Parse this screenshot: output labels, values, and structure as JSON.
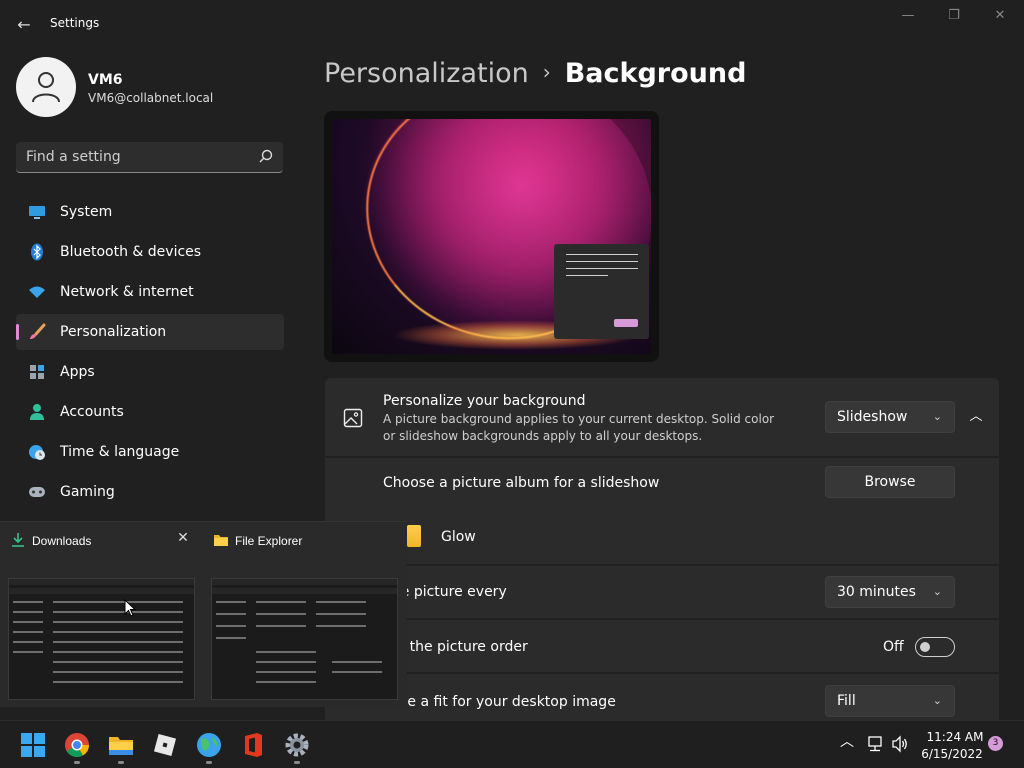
{
  "window": {
    "title": "Settings",
    "back_glyph": "←",
    "controls": {
      "minimize": "—",
      "maximize": "❐",
      "close": "✕"
    }
  },
  "profile": {
    "name": "VM6",
    "email": "VM6@collabnet.local"
  },
  "search": {
    "placeholder": "Find a setting",
    "icon": "search-icon"
  },
  "sidebar": {
    "items": [
      {
        "label": "System",
        "icon": "monitor-icon",
        "active": false
      },
      {
        "label": "Bluetooth & devices",
        "icon": "bluetooth-icon",
        "active": false
      },
      {
        "label": "Network & internet",
        "icon": "wifi-icon",
        "active": false
      },
      {
        "label": "Personalization",
        "icon": "brush-icon",
        "active": true
      },
      {
        "label": "Apps",
        "icon": "apps-icon",
        "active": false
      },
      {
        "label": "Accounts",
        "icon": "person-icon",
        "active": false
      },
      {
        "label": "Time & language",
        "icon": "globe-clock-icon",
        "active": false
      },
      {
        "label": "Gaming",
        "icon": "gamepad-icon",
        "active": false
      }
    ],
    "active_color": "#e08ad8"
  },
  "breadcrumb": {
    "parent": "Personalization",
    "separator": "›",
    "current": "Background"
  },
  "background_card": {
    "title": "Personalize your background",
    "description": "A picture background applies to your current desktop. Solid color or slideshow backgrounds apply to all your desktops.",
    "selected": "Slideshow",
    "chevron": "⌄",
    "collapse_glyph": "︿"
  },
  "settings": {
    "album": {
      "label": "Choose a picture album for a slideshow",
      "button": "Browse",
      "folder_name": "Glow"
    },
    "interval": {
      "label": "nge picture every",
      "value": "30 minutes"
    },
    "shuffle": {
      "label": "ffle the picture order",
      "state": "Off"
    },
    "fit": {
      "label": "oose a fit for your desktop image",
      "value": "Fill"
    }
  },
  "thumbnails": [
    {
      "title": "Downloads",
      "icon": "download-icon",
      "close": "✕"
    },
    {
      "title": "File Explorer",
      "icon": "folder-icon"
    }
  ],
  "taskbar": {
    "apps": [
      "start-icon",
      "chrome-icon",
      "file-explorer-icon",
      "roblox-icon",
      "edge-globe-icon",
      "office-icon",
      "settings-gear-icon"
    ],
    "tray": {
      "chevron": "︿",
      "time": "11:24 AM",
      "date": "6/15/2022",
      "notifications": "3"
    }
  },
  "colors": {
    "accent": "#d79ad9",
    "background": "#202020",
    "card": "#2b2b2b"
  }
}
